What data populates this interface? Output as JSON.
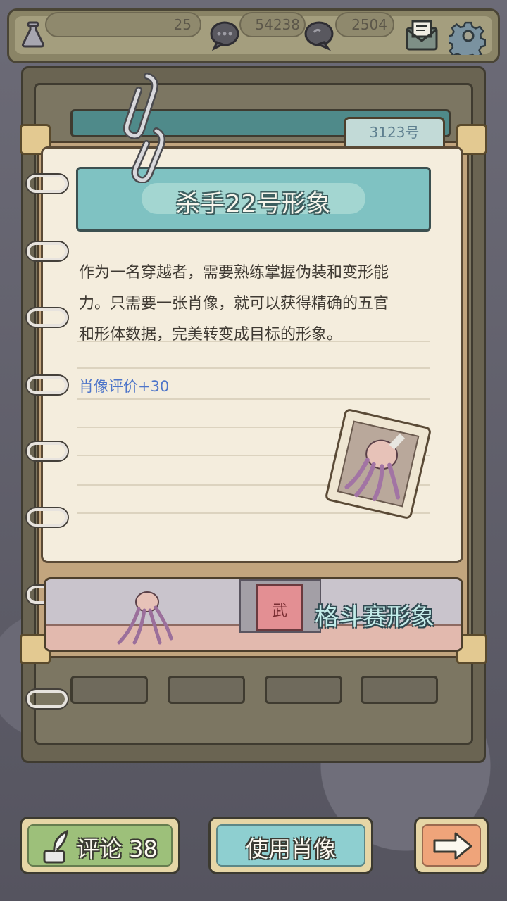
{
  "topbar": {
    "res1_value": "25",
    "res2_value": "54238",
    "res3_value": "2504"
  },
  "notebook": {
    "tag_number": "3123号",
    "title": "杀手22号形象",
    "description_lines": [
      "作为一名穿越者，需要熟练掌握伪装和变形能",
      "力。只需要一张肖像，就可以获得精确的五官",
      "和形体数据，完美转变成目标的形象。"
    ],
    "rating_text": "肖像评价+30",
    "stage_banner_char": "武",
    "stage_label": "格斗赛形象"
  },
  "buttons": {
    "comment_label": "评论 38",
    "use_label": "使用肖像"
  },
  "colors": {
    "title_banner": "#7fc2c2",
    "comment_btn": "#9dc07a",
    "use_btn": "#8ecfd0",
    "next_btn": "#efa47a"
  }
}
